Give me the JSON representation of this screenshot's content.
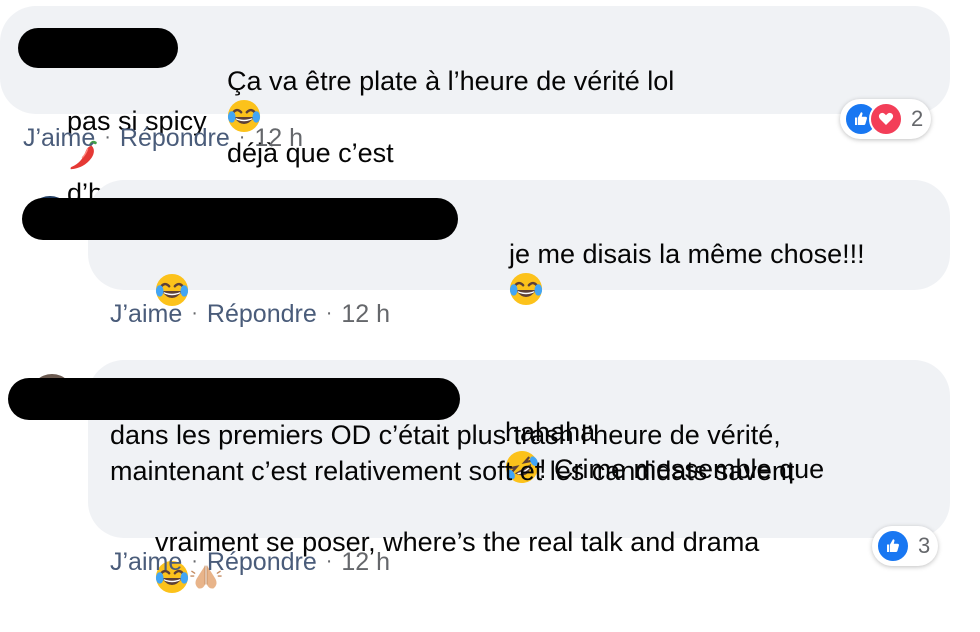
{
  "comments": [
    {
      "text_line1": "Ça va être plate à l’heure de vérité lol",
      "text_line1_after": "déjà que c’est",
      "text_line2": "pas si spicy",
      "text_line2_after": "d’habitude!",
      "actions": {
        "like": "J’aime",
        "reply": "Répondre",
        "time": "12 h"
      },
      "reactions": {
        "count": "2",
        "types": [
          "like-icon",
          "love-icon"
        ]
      }
    },
    {
      "text_line1": "je me disais la même chose!!!",
      "actions": {
        "like": "J’aime",
        "reply": "Répondre",
        "time": "12 h"
      }
    },
    {
      "text_line1": "hahaha",
      "text_line1_after": "! Crime messemble que",
      "text_line2": "dans les premiers OD c’était plus trash l’heure de vérité,",
      "text_line3": "maintenant c’est relativement soft et les candidats savent",
      "text_line4": "vraiment se poser, where’s the real talk and drama",
      "actions": {
        "like": "J’aime",
        "reply": "Répondre",
        "time": "12 h"
      },
      "reactions": {
        "count": "3",
        "types": [
          "like-icon"
        ]
      }
    }
  ],
  "separator": "·",
  "colors": {
    "bubble": "#f0f2f5",
    "link": "#4a5c7a",
    "like_blue": "#1877f2",
    "love_red": "#f33e58"
  }
}
